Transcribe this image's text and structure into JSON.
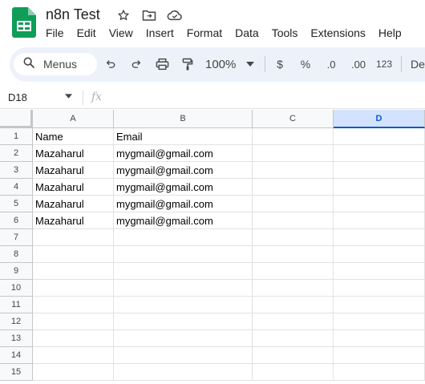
{
  "document": {
    "title": "n8n Test",
    "icons": [
      "star-icon",
      "move-to-folder-icon",
      "cloud-saved-icon"
    ]
  },
  "menu": {
    "items": [
      "File",
      "Edit",
      "View",
      "Insert",
      "Format",
      "Data",
      "Tools",
      "Extensions",
      "Help"
    ]
  },
  "toolbar": {
    "search_label": "Menus",
    "zoom": "100%",
    "currency": "$",
    "percent": "%",
    "decrease_decimal": ".0",
    "increase_decimal": ".00",
    "more_formats": "123",
    "default_font": "De",
    "icons": [
      "undo-icon",
      "redo-icon",
      "print-icon",
      "paint-format-icon"
    ]
  },
  "formula_bar": {
    "name_box": "D18",
    "fx_label": "fx",
    "value": ""
  },
  "sheet": {
    "columns": [
      "A",
      "B",
      "C",
      "D"
    ],
    "selected_column": "D",
    "row_numbers": [
      "1",
      "2",
      "3",
      "4",
      "5",
      "6",
      "7",
      "8",
      "9",
      "10",
      "11",
      "12",
      "13",
      "14",
      "15"
    ],
    "rows": [
      [
        "Name",
        "Email",
        "",
        ""
      ],
      [
        "Mazaharul",
        "mygmail@gmail.com",
        "",
        ""
      ],
      [
        "Mazaharul",
        "mygmail@gmail.com",
        "",
        ""
      ],
      [
        "Mazaharul",
        "mygmail@gmail.com",
        "",
        ""
      ],
      [
        "Mazaharul",
        "mygmail@gmail.com",
        "",
        ""
      ],
      [
        "Mazaharul",
        "mygmail@gmail.com",
        "",
        ""
      ],
      [
        "",
        "",
        "",
        ""
      ],
      [
        "",
        "",
        "",
        ""
      ],
      [
        "",
        "",
        "",
        ""
      ],
      [
        "",
        "",
        "",
        ""
      ],
      [
        "",
        "",
        "",
        ""
      ],
      [
        "",
        "",
        "",
        ""
      ],
      [
        "",
        "",
        "",
        ""
      ],
      [
        "",
        "",
        "",
        ""
      ],
      [
        "",
        "",
        "",
        ""
      ]
    ]
  },
  "colors": {
    "brand_green": "#0f9d58",
    "toolbar_bg": "#edf2fa",
    "selected_header_bg": "#d3e3fd",
    "selected_header_text": "#0b57d0"
  }
}
